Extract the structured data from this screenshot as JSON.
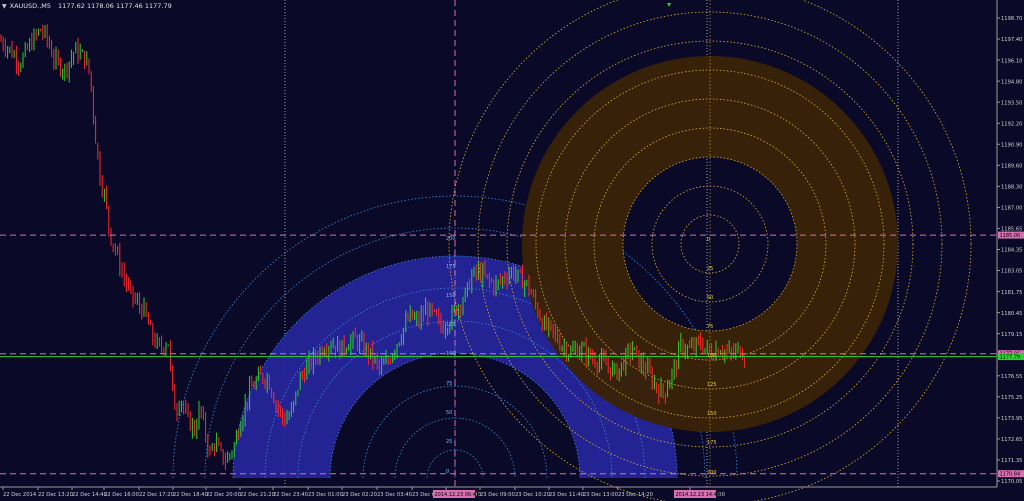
{
  "header": {
    "menu_icon": "dropdown-triangle-icon",
    "symbol": "XAUUSD.,M5",
    "ohlc": "1177.62 1178.06 1177.46 1177.79"
  },
  "colors": {
    "background": "#0a0a28",
    "bull": "#2bd12b",
    "bear": "#ff2a2a",
    "blue_fill": "#25259a",
    "brown_fill": "#3a2208",
    "circle_dots": "#d8b030",
    "blue_dots": "#3a8ad8",
    "pink_lines": "#d86fb0",
    "green_line": "#26d42a"
  },
  "chart_data": {
    "type": "candlestick",
    "price_axis": [
      "1198.70",
      "1197.40",
      "1196.10",
      "1194.80",
      "1193.50",
      "1192.20",
      "1190.90",
      "1189.60",
      "1188.30",
      "1187.00",
      "1185.65",
      "1184.35",
      "1183.05",
      "1181.75",
      "1180.45",
      "1179.15",
      "1177.85",
      "1176.55",
      "1175.25",
      "1173.95",
      "1172.65",
      "1171.35",
      "1170.05"
    ],
    "price_range": [
      1170.05,
      1198.95
    ],
    "time_axis": [
      "22 Dec 2014",
      "22 Dec 13:20",
      "22 Dec 14:40",
      "22 Dec 16:00",
      "22 Dec 17:20",
      "22 Dec 18:40",
      "22 Dec 20:00",
      "22 Dec 21:20",
      "22 Dec 23:40",
      "23 Dec 01:00",
      "23 Dec 02:20",
      "23 Dec 03:40",
      "23 Dec 05",
      "23 Dec 07:40",
      "23 Dec 09:00",
      "23 Dec 10:20",
      "23 Dec 11:40",
      "23 Dec 13:00",
      "23 Dec 14:20",
      "23 Dec 17:00"
    ],
    "horizontal_labels": [
      {
        "price": 1185.0,
        "label": "1185.00",
        "color": "#d86fb0"
      },
      {
        "price": 1177.96,
        "label": "1177.96",
        "color": "#d86fb0"
      },
      {
        "price": 1177.79,
        "label": "1177.79",
        "color": "#26d42a"
      },
      {
        "price": 1170.84,
        "label": "1170.84",
        "color": "#d86fb0"
      }
    ],
    "time_markers": [
      "2014.12.23 06:45",
      "2014.12.23 14:45"
    ],
    "blue_scale": [
      "200",
      "175",
      "150",
      "125",
      "100",
      "75",
      "50",
      "25",
      "0"
    ],
    "brown_scale": [
      "0",
      "25",
      "50",
      "75",
      "100",
      "125",
      "150",
      "175",
      "200"
    ],
    "path": [
      [
        0,
        1196.6
      ],
      [
        10,
        1196.0
      ],
      [
        20,
        1195.2
      ],
      [
        30,
        1196.3
      ],
      [
        40,
        1197.2
      ],
      [
        46,
        1196.8
      ],
      [
        55,
        1195.3
      ],
      [
        65,
        1194.8
      ],
      [
        75,
        1196.0
      ],
      [
        85,
        1195.5
      ],
      [
        90,
        1194.5
      ],
      [
        96,
        1190.5
      ],
      [
        100,
        1188.5
      ],
      [
        105,
        1187.2
      ],
      [
        110,
        1185.0
      ],
      [
        115,
        1184.2
      ],
      [
        120,
        1183.2
      ],
      [
        128,
        1181.8
      ],
      [
        136,
        1181.0
      ],
      [
        144,
        1180.5
      ],
      [
        152,
        1179.0
      ],
      [
        160,
        1178.2
      ],
      [
        168,
        1178.8
      ],
      [
        172,
        1175.8
      ],
      [
        176,
        1174.5
      ],
      [
        180,
        1175.5
      ],
      [
        186,
        1174.2
      ],
      [
        195,
        1173.4
      ],
      [
        200,
        1174.8
      ],
      [
        205,
        1173.3
      ],
      [
        210,
        1172.0
      ],
      [
        215,
        1172.8
      ],
      [
        220,
        1172.0
      ],
      [
        226,
        1171.6
      ],
      [
        234,
        1172.5
      ],
      [
        242,
        1174.3
      ],
      [
        250,
        1175.8
      ],
      [
        260,
        1176.6
      ],
      [
        268,
        1176.5
      ],
      [
        276,
        1175.0
      ],
      [
        284,
        1174.0
      ],
      [
        292,
        1174.5
      ],
      [
        300,
        1176.5
      ],
      [
        308,
        1177.2
      ],
      [
        316,
        1177.8
      ],
      [
        324,
        1178.4
      ],
      [
        332,
        1178.6
      ],
      [
        340,
        1178.2
      ],
      [
        348,
        1178.6
      ],
      [
        356,
        1178.8
      ],
      [
        364,
        1178.3
      ],
      [
        372,
        1177.8
      ],
      [
        380,
        1177.0
      ],
      [
        388,
        1177.5
      ],
      [
        396,
        1178.5
      ],
      [
        404,
        1179.5
      ],
      [
        410,
        1180.2
      ],
      [
        418,
        1179.8
      ],
      [
        426,
        1180.6
      ],
      [
        434,
        1180.2
      ],
      [
        442,
        1179.5
      ],
      [
        450,
        1180.0
      ],
      [
        458,
        1180.8
      ],
      [
        466,
        1181.5
      ],
      [
        472,
        1182.6
      ],
      [
        480,
        1182.8
      ],
      [
        488,
        1182.3
      ],
      [
        496,
        1182.0
      ],
      [
        504,
        1182.5
      ],
      [
        512,
        1182.9
      ],
      [
        520,
        1182.4
      ],
      [
        528,
        1182.0
      ],
      [
        536,
        1180.8
      ],
      [
        544,
        1179.6
      ],
      [
        552,
        1179.3
      ],
      [
        560,
        1178.6
      ],
      [
        570,
        1178.0
      ],
      [
        580,
        1178.3
      ],
      [
        590,
        1177.8
      ],
      [
        600,
        1177.5
      ],
      [
        608,
        1177.2
      ],
      [
        616,
        1176.8
      ],
      [
        624,
        1177.5
      ],
      [
        632,
        1178.3
      ],
      [
        640,
        1177.4
      ],
      [
        648,
        1176.9
      ],
      [
        656,
        1176.0
      ],
      [
        664,
        1175.6
      ],
      [
        670,
        1176.5
      ],
      [
        676,
        1177.3
      ],
      [
        680,
        1178.4
      ],
      [
        690,
        1178.2
      ],
      [
        700,
        1178.6
      ],
      [
        710,
        1178.0
      ],
      [
        720,
        1178.3
      ],
      [
        730,
        1177.9
      ],
      [
        740,
        1178.2
      ],
      [
        746,
        1177.8
      ]
    ]
  }
}
